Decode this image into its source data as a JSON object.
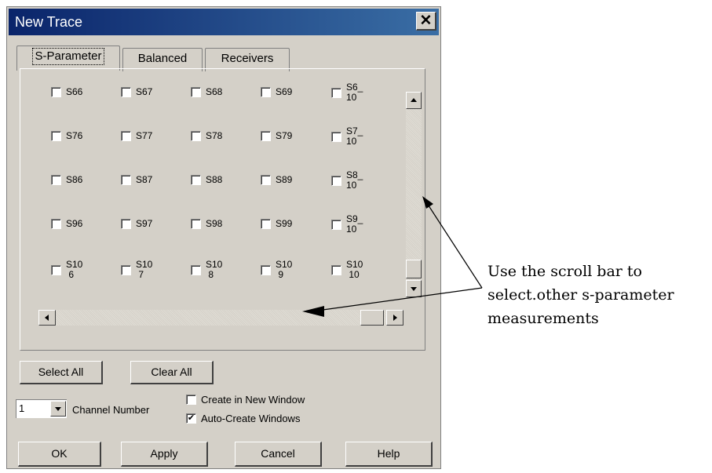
{
  "dialog": {
    "title": "New Trace",
    "close_glyph": "✕"
  },
  "tabs": [
    {
      "label": "S-Parameter",
      "active": true
    },
    {
      "label": "Balanced",
      "active": false
    },
    {
      "label": "Receivers",
      "active": false
    }
  ],
  "params": [
    [
      "S66",
      "S67",
      "S68",
      "S69",
      "S6_\n10"
    ],
    [
      "S76",
      "S77",
      "S78",
      "S79",
      "S7_\n10"
    ],
    [
      "S86",
      "S87",
      "S88",
      "S89",
      "S8_\n10"
    ],
    [
      "S96",
      "S97",
      "S98",
      "S99",
      "S9_\n10"
    ],
    [
      "S10\n 6",
      "S10\n 7",
      "S10\n 8",
      "S10\n 9",
      "S10\n 10"
    ]
  ],
  "buttons": {
    "select_all": "Select All",
    "clear_all": "Clear All",
    "ok": "OK",
    "apply": "Apply",
    "cancel": "Cancel",
    "help": "Help"
  },
  "channel": {
    "value": "1",
    "label": "Channel Number"
  },
  "options": {
    "create_new_window": "Create in New Window",
    "create_new_window_checked": false,
    "auto_create_windows": "Auto-Create Windows",
    "auto_create_windows_checked": true
  },
  "annotation": {
    "line1": "Use the scroll bar to",
    "line2": "select.other s-parameter",
    "line3": "measurements"
  },
  "icons": {
    "scroll_up": "scroll-up-arrow-icon",
    "scroll_down": "scroll-down-arrow-icon",
    "scroll_left": "scroll-left-arrow-icon",
    "scroll_right": "scroll-right-arrow-icon",
    "dropdown": "chevron-down-icon"
  },
  "colors": {
    "titlebar_start": "#0a246a",
    "titlebar_end": "#3a6ea5",
    "dialog_bg": "#d4d0c8"
  }
}
